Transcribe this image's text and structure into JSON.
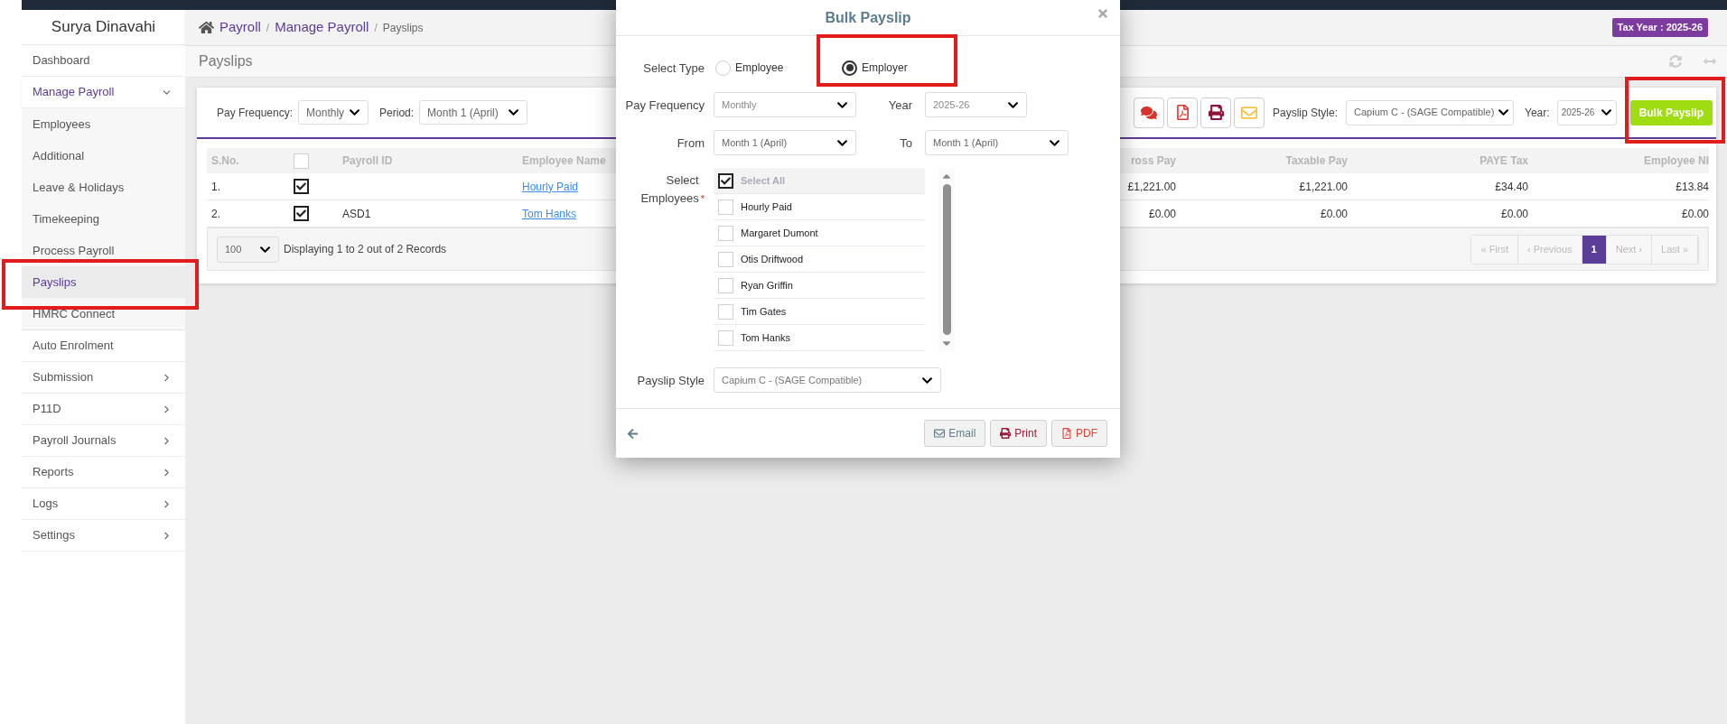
{
  "sidebar": {
    "user": "Surya Dinavahi",
    "items": [
      {
        "label": "Dashboard",
        "kind": "link",
        "selected": false
      },
      {
        "label": "Manage Payroll",
        "kind": "group",
        "selected": true,
        "expanded": true,
        "children": [
          {
            "label": "Employees",
            "selected": false
          },
          {
            "label": "Additional",
            "selected": false
          },
          {
            "label": "Leave & Holidays",
            "selected": false
          },
          {
            "label": "Timekeeping",
            "selected": false
          },
          {
            "label": "Process Payroll",
            "selected": false
          },
          {
            "label": "Payslips",
            "selected": true
          },
          {
            "label": "HMRC Connect",
            "selected": false
          }
        ]
      },
      {
        "label": "Auto Enrolment",
        "kind": "link",
        "selected": false
      },
      {
        "label": "Submission",
        "kind": "group",
        "selected": false,
        "expanded": false
      },
      {
        "label": "P11D",
        "kind": "group",
        "selected": false,
        "expanded": false
      },
      {
        "label": "Payroll Journals",
        "kind": "group",
        "selected": false,
        "expanded": false
      },
      {
        "label": "Reports",
        "kind": "group",
        "selected": false,
        "expanded": false
      },
      {
        "label": "Logs",
        "kind": "group",
        "selected": false,
        "expanded": false
      },
      {
        "label": "Settings",
        "kind": "group",
        "selected": false,
        "expanded": false
      }
    ]
  },
  "breadcrumb": [
    {
      "kind": "link",
      "text": "Payroll"
    },
    {
      "kind": "separator",
      "text": "/"
    },
    {
      "kind": "link",
      "text": "Manage Payroll"
    },
    {
      "kind": "separator",
      "text": "/"
    },
    {
      "kind": "current",
      "text": "Payslips"
    }
  ],
  "tax_year": "Tax Year : 2025-26",
  "page_title": "Payslips",
  "filters": {
    "pay_frequency": {
      "label": "Pay Frequency:",
      "value": "Monthly"
    },
    "period": {
      "label": "Period:",
      "value": "Month 1 (April)"
    }
  },
  "toolbar": {
    "payslip_style": {
      "label": "Payslip Style:",
      "value": "Capium C - (SAGE Compatible)"
    },
    "year": {
      "label": "Year:",
      "value": "2025-26"
    },
    "bulk_button": "Bulk Payslip"
  },
  "table": {
    "columns_left": [
      "S.No.",
      "Payroll ID",
      "Employee Name"
    ],
    "header_checked": false,
    "columns_right": [
      "ross Pay",
      "Taxable Pay",
      "PAYE Tax",
      "Employee NI"
    ],
    "rows": [
      {
        "sno": "1.",
        "checked": true,
        "name": "Hourly Paid",
        "amounts": [
          "£1,221.00",
          "£1,221.00",
          "£34.40",
          "£13.84"
        ]
      },
      {
        "sno": "2.",
        "checked": true,
        "payroll_id": "ASD1",
        "name": "Tom Hanks",
        "amounts": [
          "£0.00",
          "£0.00",
          "£0.00",
          "£0.00"
        ]
      }
    ]
  },
  "footer": {
    "page_size": "100",
    "summary": "Displaying 1 to 2 out of 2 Records",
    "pages": [
      {
        "label": "« First",
        "selected": false,
        "disabled": true
      },
      {
        "label": "‹ Previous",
        "selected": false,
        "disabled": true
      },
      {
        "label": "1",
        "selected": true,
        "disabled": false
      },
      {
        "label": "Next ›",
        "selected": false,
        "disabled": true
      },
      {
        "label": "Last »",
        "selected": false,
        "disabled": true
      }
    ]
  },
  "modal": {
    "title": "Bulk Payslip",
    "select_type": {
      "label": "Select Type",
      "options": [
        {
          "label": "Employee",
          "selected": false
        },
        {
          "label": "Employer",
          "selected": true
        }
      ]
    },
    "pay_frequency": {
      "label": "Pay Frequency",
      "value": "Monthly"
    },
    "year": {
      "label": "Year",
      "value": "2025-26"
    },
    "from": {
      "label": "From",
      "value": "Month 1 (April)"
    },
    "to": {
      "label": "To",
      "value": "Month 1 (April)"
    },
    "employees": {
      "label": "Select Employees",
      "required_mark": "*",
      "items": [
        {
          "label": "Select All",
          "kind": "all",
          "checked": true
        },
        {
          "label": "Hourly Paid",
          "kind": "employee",
          "checked": false
        },
        {
          "label": "Margaret Dumont",
          "kind": "employee",
          "checked": false
        },
        {
          "label": "Otis Driftwood",
          "kind": "employee",
          "checked": false
        },
        {
          "label": "Ryan Griffin",
          "kind": "employee",
          "checked": false
        },
        {
          "label": "Tim Gates",
          "kind": "employee",
          "checked": false
        },
        {
          "label": "Tom Hanks",
          "kind": "employee",
          "checked": false
        }
      ]
    },
    "payslip_style": {
      "label": "Payslip Style",
      "value": "Capium C - (SAGE Compatible)"
    },
    "buttons": [
      {
        "label": "Email",
        "kind": "email"
      },
      {
        "label": "Print",
        "kind": "print"
      },
      {
        "label": "PDF",
        "kind": "pdf"
      }
    ]
  }
}
